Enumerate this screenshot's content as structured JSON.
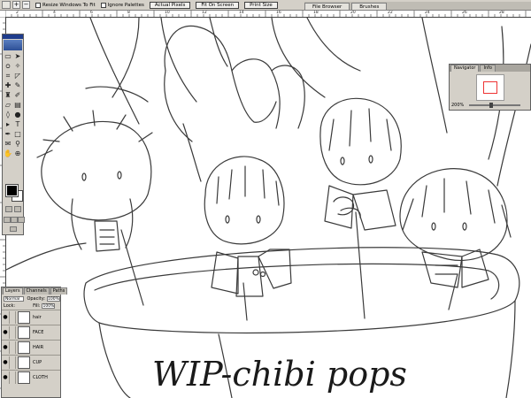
{
  "options_bar": {
    "resize_windows_label": "Resize Windows To Fit",
    "ignore_palettes_label": "Ignore Palettes",
    "actual_pixels_label": "Actual Pixels",
    "fit_on_screen_label": "Fit On Screen",
    "print_size_label": "Print Size",
    "zoom_in_symbol": "+",
    "zoom_out_symbol": "−"
  },
  "palette_well": {
    "tabs": [
      "File Browser",
      "Brushes"
    ]
  },
  "ruler_top_labels": [
    "2",
    "4",
    "6",
    "8",
    "10",
    "12",
    "14",
    "16",
    "18",
    "20",
    "22",
    "24",
    "26",
    "28"
  ],
  "navigator": {
    "tabs": [
      "Navigator",
      "Info"
    ],
    "zoom": "200%"
  },
  "layers_panel": {
    "tabs": [
      "Layers",
      "Channels",
      "Paths"
    ],
    "blend_mode": "Normal",
    "opacity_label": "Opacity:",
    "opacity_value": "100%",
    "lock_label": "Lock:",
    "fill_label": "Fill:",
    "fill_value": "100%",
    "layers": [
      "hair",
      "FACE",
      "HAIR",
      "CUP",
      "CLOTH"
    ]
  },
  "artwork": {
    "title_text": "WIP-chibi pops"
  },
  "colors": {
    "foreground": "#000000",
    "background": "#ffffff",
    "panel": "#d4d0c8",
    "ink": "#333333"
  }
}
